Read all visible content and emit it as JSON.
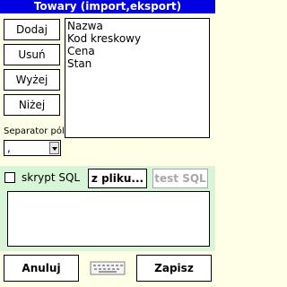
{
  "window": {
    "title": "Towary (import,eksport)"
  },
  "buttons": {
    "add": "Dodaj",
    "remove": "Usuń",
    "up": "Wyżej",
    "down": "Niżej",
    "from_file": "z pliku...",
    "test_sql": "test SQL",
    "cancel": "Anuluj",
    "save": "Zapisz"
  },
  "fields": {
    "items": [
      "Nazwa",
      "Kod kreskowy",
      "Cena",
      "Stan"
    ]
  },
  "separator": {
    "label": "Separator pól",
    "value": ","
  },
  "sql": {
    "checkbox_label": "skrypt SQL",
    "checked": false,
    "script_text": ""
  },
  "icons": {
    "keyboard": "keyboard-icon"
  },
  "colors": {
    "titlebar": "#0000e0",
    "background": "#ffffe8",
    "sql_panel": "#d8f5d8"
  }
}
